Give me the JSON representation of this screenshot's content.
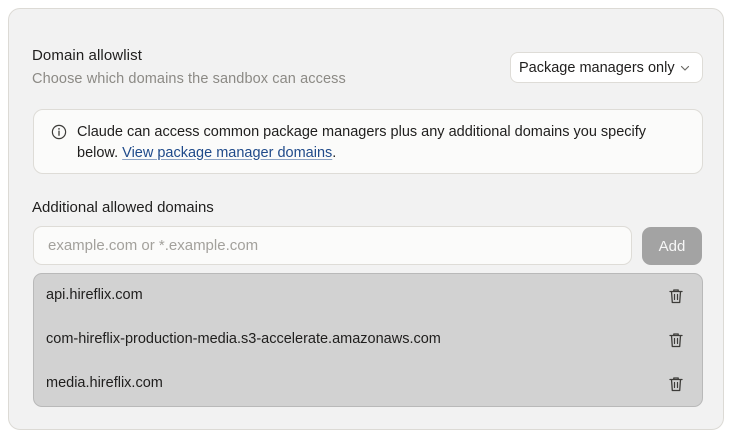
{
  "allowlist": {
    "title": "Domain allowlist",
    "description": "Choose which domains the sandbox can access",
    "mode_selected": "Package managers only"
  },
  "info": {
    "text": "Claude can access common package managers plus any additional domains you specify below.",
    "link_label": "View package manager domains",
    "trailing": ".",
    "icon": "info-icon"
  },
  "additional": {
    "label": "Additional allowed domains",
    "input_placeholder": "example.com or *.example.com",
    "input_value": "",
    "add_label": "Add"
  },
  "domains": [
    {
      "name": "api.hireflix.com",
      "icon": "trash-icon"
    },
    {
      "name": "com-hireflix-production-media.s3-accelerate.amazonaws.com",
      "icon": "trash-icon"
    },
    {
      "name": "media.hireflix.com",
      "icon": "trash-icon"
    }
  ],
  "colors": {
    "link": "#1f4a8a",
    "add_button": "#a3a3a3",
    "list_background": "#d2d2d2"
  }
}
